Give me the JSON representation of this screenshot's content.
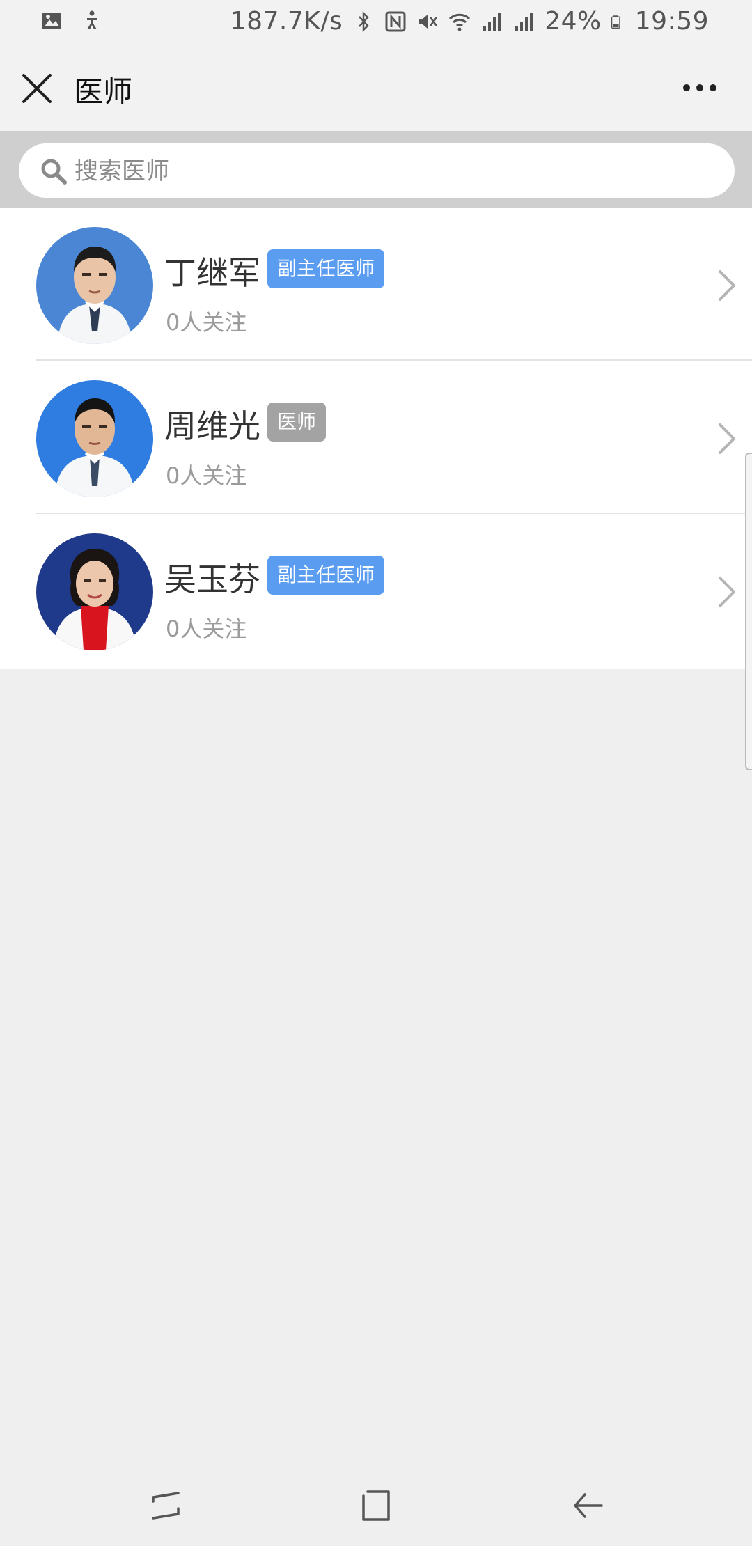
{
  "status_bar": {
    "speed": "187.7K/s",
    "battery": "24%",
    "time": "19:59"
  },
  "nav": {
    "title": "医师"
  },
  "search": {
    "placeholder": "搜索医师"
  },
  "doctors": [
    {
      "name": "丁继军",
      "title": "副主任医师",
      "followers": "0人关注",
      "badge_color": "#5a9cf0"
    },
    {
      "name": "周维光",
      "title": "医师",
      "followers": "0人关注",
      "badge_color": "#a3a3a3"
    },
    {
      "name": "吴玉芬",
      "title": "副主任医师",
      "followers": "0人关注",
      "badge_color": "#5a9cf0"
    }
  ],
  "colors": {
    "accent_badge": "#5a9cf0",
    "neutral_badge": "#a3a3a3",
    "page_bg": "#efefef",
    "search_band": "#cfcfcf"
  },
  "icons": {
    "close": "close-icon",
    "more": "more-icon",
    "search": "search-icon",
    "chevron": "chevron-right-icon"
  }
}
